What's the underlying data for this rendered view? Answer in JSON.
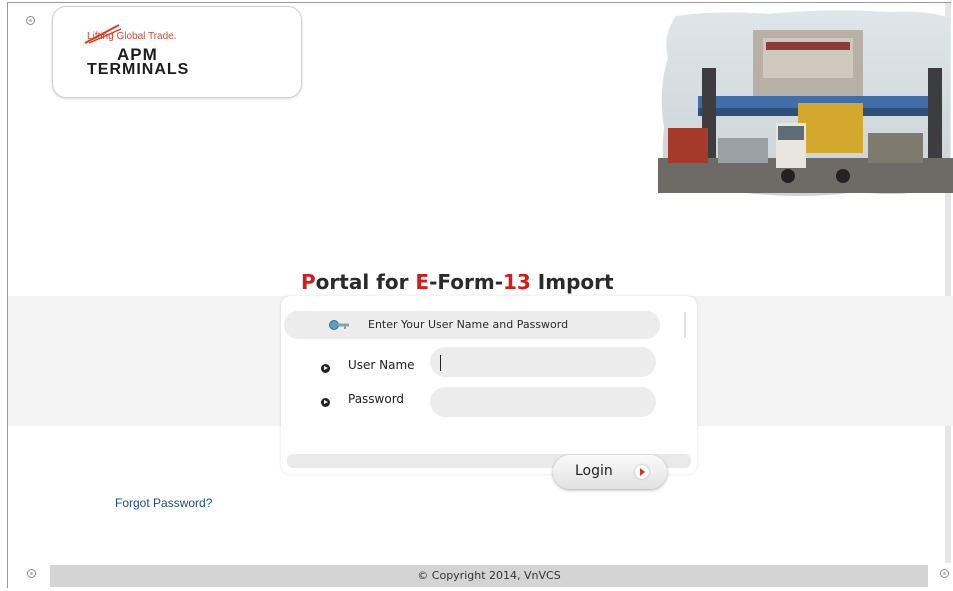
{
  "logo": {
    "tagline": "Lifting Global Trade.",
    "line1": "APM",
    "line2": "TERMINALS"
  },
  "banner_icon": "container-terminal-photo",
  "portal_title": {
    "p1_red": "P",
    "p1_rest": "ortal for ",
    "e_red": "E",
    "form": "-Form-",
    "num_red": "13",
    "rest": " Import"
  },
  "login": {
    "hint": "Enter Your User Name and Password",
    "username_label": "User Name",
    "username_value": "",
    "password_label": "Password",
    "password_value": "",
    "button_label": "Login"
  },
  "links": {
    "forgot_password": "Forgot Password?"
  },
  "footer": {
    "copyright": "© Copyright 2014, VnVCS"
  },
  "colors": {
    "accent_red": "#d41c1c",
    "link_blue": "#1a4a8a"
  }
}
